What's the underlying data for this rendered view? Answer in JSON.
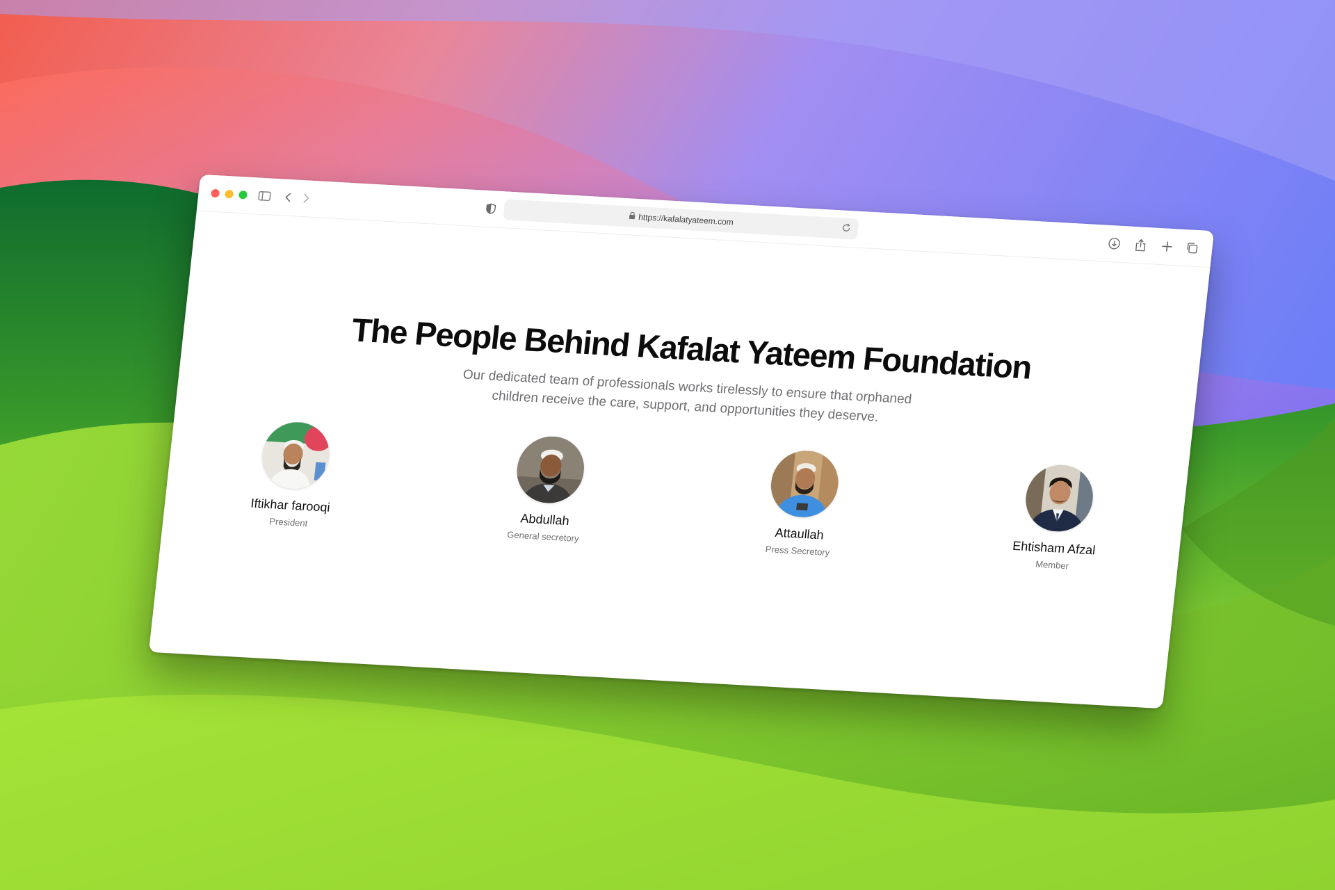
{
  "browser": {
    "url": "https://kafalatyateem.com"
  },
  "page": {
    "headline": "The People Behind Kafalat Yateem Foundation",
    "subtitle": "Our dedicated team of professionals works tirelessly to ensure that orphaned children receive the care, support, and opportunities they deserve."
  },
  "team": [
    {
      "name": "Iftikhar farooqi",
      "role": "President"
    },
    {
      "name": "Abdullah",
      "role": "General secretory"
    },
    {
      "name": "Attaullah",
      "role": "Press Secretory"
    },
    {
      "name": "Ehtisham Afzal",
      "role": "Member"
    }
  ],
  "colors": {
    "wallpaper_top": "#f2675d",
    "wallpaper_purple": "#8a7cf5",
    "wallpaper_green": "#8fd634",
    "traffic_red": "#ff5f57",
    "traffic_yellow": "#febc2e",
    "traffic_green": "#28c840"
  },
  "icons": {
    "toolbar": [
      "sidebar-icon",
      "back-icon",
      "forward-icon",
      "shield-icon",
      "lock-icon",
      "reload-icon",
      "download-icon",
      "share-icon",
      "plus-icon",
      "tabs-icon"
    ]
  }
}
